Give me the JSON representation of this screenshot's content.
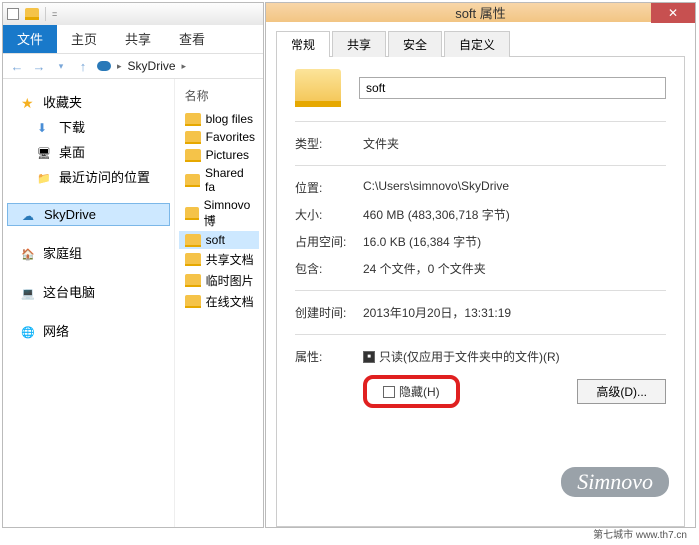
{
  "explorer": {
    "ribbon": {
      "file": "文件",
      "home": "主页",
      "share": "共享",
      "view": "查看"
    },
    "breadcrumb": "SkyDrive",
    "tree": {
      "favorites": "收藏夹",
      "downloads": "下载",
      "desktop": "桌面",
      "recent": "最近访问的位置",
      "skydrive": "SkyDrive",
      "homegroup": "家庭组",
      "thispc": "这台电脑",
      "network": "网络"
    },
    "list_header": "名称",
    "items": [
      "blog files",
      "Favorites",
      "Pictures",
      "Shared fa",
      "Simnovo博",
      "soft",
      "共享文档",
      "临时图片",
      "在线文档"
    ]
  },
  "props": {
    "title": "soft 属性",
    "tabs": {
      "general": "常规",
      "share": "共享",
      "security": "安全",
      "custom": "自定义"
    },
    "name": "soft",
    "rows": {
      "type_lbl": "类型:",
      "type_val": "文件夹",
      "loc_lbl": "位置:",
      "loc_val": "C:\\Users\\simnovo\\SkyDrive",
      "size_lbl": "大小:",
      "size_val": "460 MB (483,306,718 字节)",
      "ondisk_lbl": "占用空间:",
      "ondisk_val": "16.0 KB (16,384 字节)",
      "contains_lbl": "包含:",
      "contains_val": "24 个文件，0 个文件夹",
      "created_lbl": "创建时间:",
      "created_val": "2013年10月20日，13:31:19",
      "attr_lbl": "属性:",
      "readonly": "只读(仅应用于文件夹中的文件)(R)",
      "hidden": "隐藏(H)",
      "advanced": "高级(D)..."
    }
  },
  "watermark": "Simnovo",
  "footer": "第七城市 www.th7.cn"
}
